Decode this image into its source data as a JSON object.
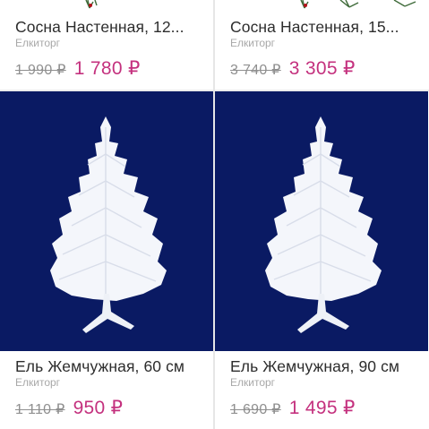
{
  "products": [
    {
      "title": "Сосна Настенная, 12...",
      "vendor": "Елкиторг",
      "old_price": "1 990 ₽",
      "new_price": "1 780 ₽",
      "image": "pine-branch-image"
    },
    {
      "title": "Сосна Настенная, 15...",
      "vendor": "Елкиторг",
      "old_price": "3 740 ₽",
      "new_price": "3 305 ₽",
      "image": "pine-branch-image"
    },
    {
      "title": "Ель Жемчужная, 60 см",
      "vendor": "Елкиторг",
      "old_price": "1 110 ₽",
      "new_price": "950 ₽",
      "image": "white-christmas-tree-image"
    },
    {
      "title": "Ель Жемчужная, 90 см",
      "vendor": "Елкиторг",
      "old_price": "1 690 ₽",
      "new_price": "1 495 ₽",
      "image": "white-christmas-tree-image"
    }
  ],
  "colors": {
    "photo_background": "#0a1a63",
    "sale_price": "#c4317e",
    "old_price": "#8f8f8f",
    "vendor": "#a8a8a8"
  }
}
